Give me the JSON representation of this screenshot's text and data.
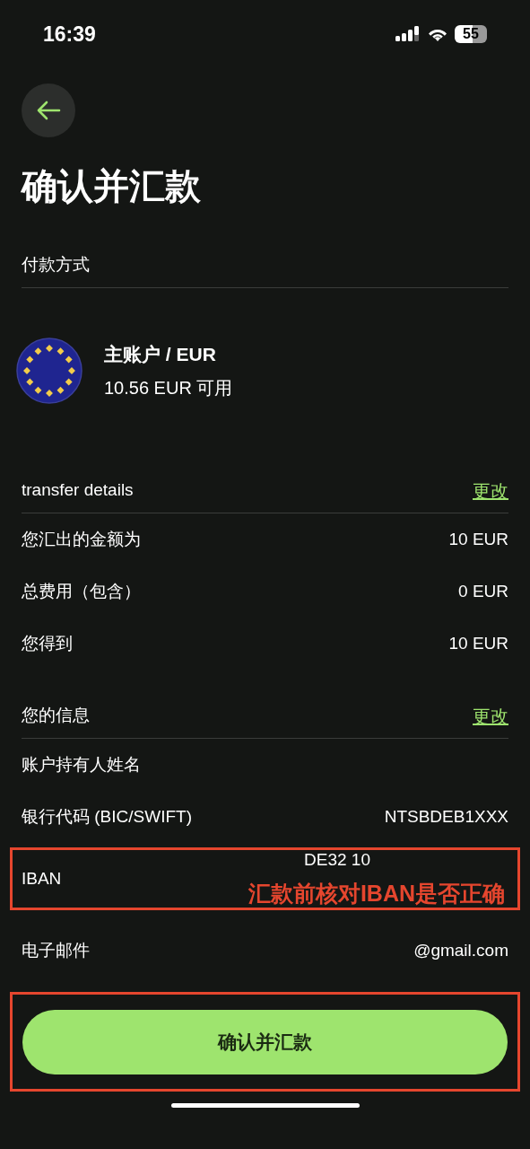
{
  "status_bar": {
    "time": "16:39",
    "battery": "55"
  },
  "title": "确认并汇款",
  "payment_method": {
    "label": "付款方式",
    "account": {
      "name": "主账户 / EUR",
      "balance": "10.56 EUR 可用"
    }
  },
  "transfer_details": {
    "title": "transfer details",
    "edit": "更改",
    "rows": [
      {
        "label": "您汇出的金额为",
        "value": "10 EUR"
      },
      {
        "label": "总费用（包含）",
        "value": "0 EUR"
      },
      {
        "label": "您得到",
        "value": "10 EUR"
      }
    ]
  },
  "your_info": {
    "title": "您的信息",
    "edit": "更改",
    "rows": [
      {
        "kind": "plain",
        "label": "账户持有人姓名"
      },
      {
        "kind": "plain",
        "label": "银行代码 (BIC/SWIFT)",
        "value": "NTSBDEB1XXX"
      },
      {
        "kind": "highlighted",
        "label": "IBAN",
        "value": "DE32 10",
        "note": "汇款前核对IBAN是否正确"
      },
      {
        "kind": "plain",
        "label": "电子邮件",
        "value": "@gmail.com"
      }
    ]
  },
  "confirm_button": {
    "label": "确认并汇款",
    "highlighted": true
  }
}
